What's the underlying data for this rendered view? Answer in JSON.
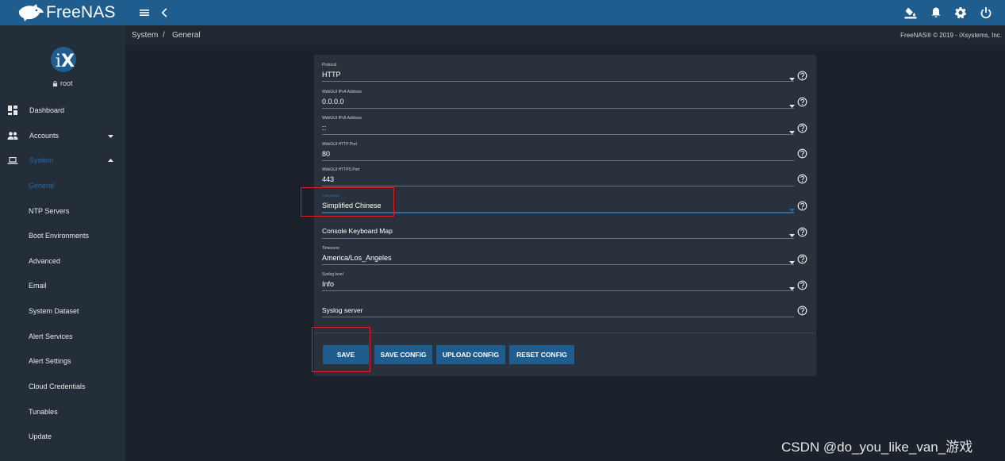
{
  "app": {
    "logo_text": "FreeNAS"
  },
  "sidebar": {
    "user": "root",
    "items": [
      {
        "label": "Dashboard"
      },
      {
        "label": "Accounts"
      },
      {
        "label": "System"
      },
      {
        "label": "General"
      },
      {
        "label": "NTP Servers"
      },
      {
        "label": "Boot Environments"
      },
      {
        "label": "Advanced"
      },
      {
        "label": "Email"
      },
      {
        "label": "System Dataset"
      },
      {
        "label": "Alert Services"
      },
      {
        "label": "Alert Settings"
      },
      {
        "label": "Cloud Credentials"
      },
      {
        "label": "Tunables"
      },
      {
        "label": "Update"
      }
    ]
  },
  "breadcrumb": {
    "parent": "System",
    "separator": "/",
    "current": "General"
  },
  "copyright": "FreeNAS® © 2019 - iXsystems, Inc.",
  "form": {
    "fields": [
      {
        "label": "Protocol",
        "value": "HTTP"
      },
      {
        "label": "WebGUI IPv4 Address",
        "value": "0.0.0.0"
      },
      {
        "label": "WebGUI IPv6 Address",
        "value": "::"
      },
      {
        "label": "WebGUI HTTP Port",
        "value": "80"
      },
      {
        "label": "WebGUI HTTPS Port",
        "value": "443"
      },
      {
        "label": "Language",
        "value": "Simplified Chinese"
      },
      {
        "label": "",
        "value": "Console Keyboard Map"
      },
      {
        "label": "Timezone",
        "value": "America/Los_Angeles"
      },
      {
        "label": "Syslog level",
        "value": "Info"
      },
      {
        "label": "",
        "value": "Syslog server"
      }
    ]
  },
  "buttons": {
    "save": "SAVE",
    "save_config": "SAVE CONFIG",
    "upload_config": "UPLOAD CONFIG",
    "reset_config": "RESET CONFIG"
  },
  "watermark": "CSDN @do_you_like_van_游戏",
  "colors": {
    "topbar": "#1f5d8f",
    "accent": "#2a6aa0",
    "highlight_box": "#e02020"
  },
  "icons": [
    "freenas-logo-icon",
    "menu-icon",
    "chevron-left-icon",
    "theme-icon",
    "bell-icon",
    "gear-icon",
    "power-icon",
    "ix-logo-icon",
    "lock-icon",
    "dashboard-icon",
    "accounts-icon",
    "laptop-icon",
    "help-icon",
    "dropdown-arrow-icon"
  ]
}
